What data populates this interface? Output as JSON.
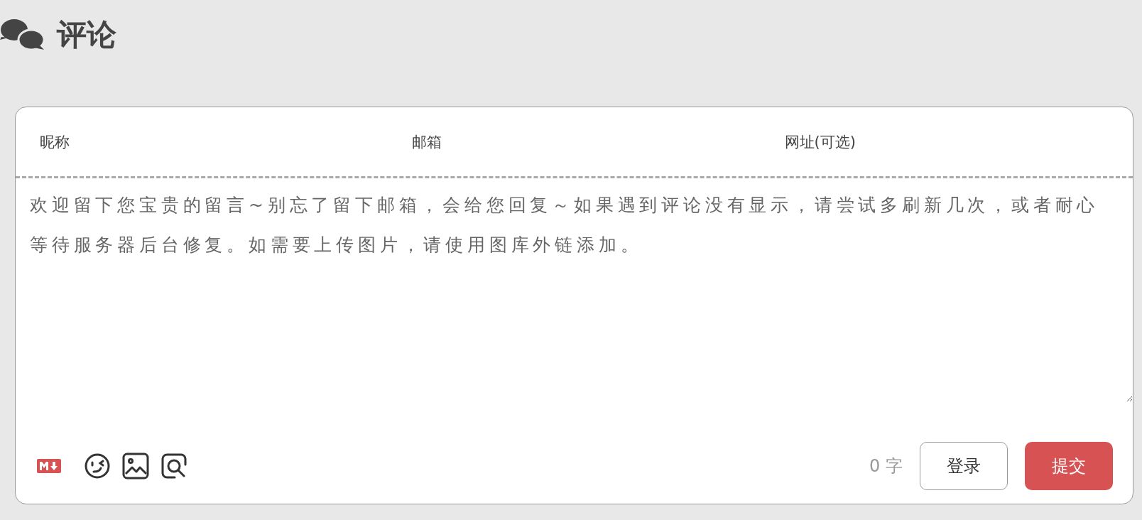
{
  "heading": {
    "title": "评论"
  },
  "form": {
    "fields": [
      {
        "placeholder": "昵称"
      },
      {
        "placeholder": "邮箱"
      },
      {
        "placeholder": "网址(可选)"
      }
    ],
    "editor": {
      "placeholder": "欢迎留下您宝贵的留言~别忘了留下邮箱，会给您回复～如果遇到评论没有显示，请尝试多刷新几次，或者耐心等待服务器后台修复。如需要上传图片，请使用图库外链添加。"
    },
    "word_count": "0 字",
    "buttons": [
      {
        "label": "登录",
        "kind": "secondary"
      },
      {
        "label": "提交",
        "kind": "primary"
      }
    ]
  }
}
